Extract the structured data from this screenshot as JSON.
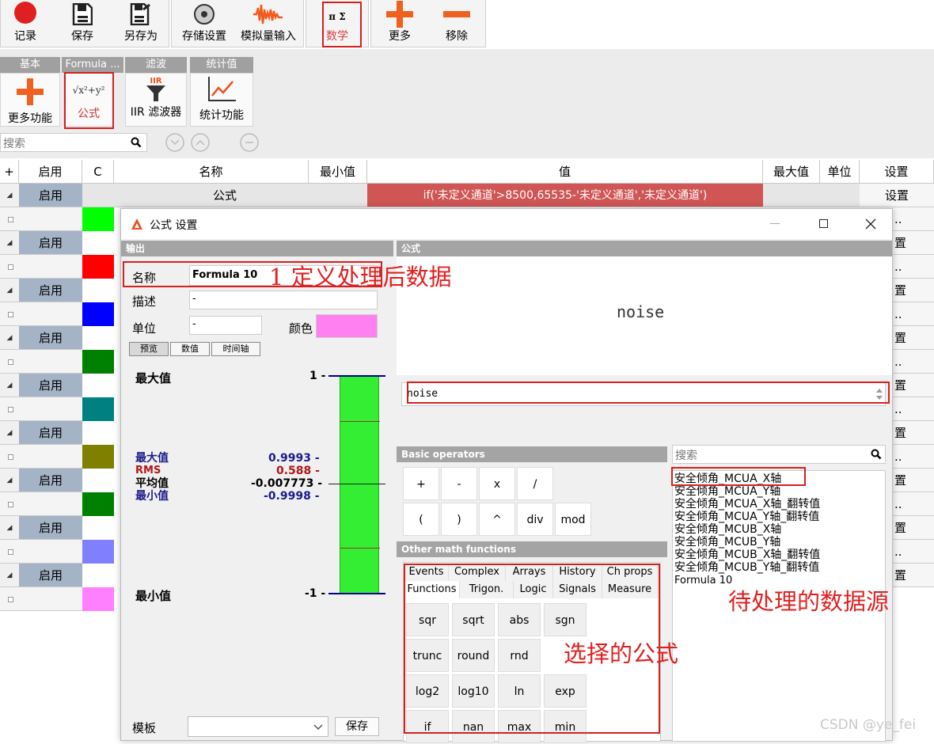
{
  "toolbar": {
    "record": "记录",
    "save": "保存",
    "save_as": "另存为",
    "storage": "存储设置",
    "analog": "模拟量输入",
    "math": "数学",
    "more": "更多",
    "remove": "移除",
    "math_glyph": "π Σ"
  },
  "ribbon": {
    "tabs": [
      "基本",
      "Formula ...",
      "滤波",
      "统计值"
    ],
    "more_func": "更多功能",
    "formula": "公式",
    "formula_icon": "√x²+y²",
    "iir": "IIR 滤波器",
    "iir_icon": "IIR",
    "stats": "统计功能"
  },
  "search": {
    "placeholder": "搜索"
  },
  "table": {
    "headers": {
      "plus": "+",
      "enable": "启用",
      "c": "C",
      "name": "名称",
      "min": "最小值",
      "value": "值",
      "max": "最大值",
      "unit": "单位",
      "settings": "设置"
    },
    "first_row": {
      "enable": "启用",
      "name": "公式",
      "value": "if('未定义通道'>8500,65535-'未定义通道','未定义通道')",
      "settings": "设置"
    },
    "enable_label": "启用",
    "settings_partial": "置",
    "ellipsis": "..",
    "swatches": [
      "#00ff00",
      "#ff0000",
      "#0000ff",
      "#008000",
      "#008080",
      "#808000",
      "#008000",
      "#8080ff",
      "#ff80ff"
    ]
  },
  "dialog": {
    "title": "公式 设置",
    "output_header": "输出",
    "formula_header": "公式",
    "name_label": "名称",
    "name_value": "Formula 10",
    "desc_label": "描述",
    "desc_value": "-",
    "unit_label": "单位",
    "unit_value": "-",
    "color_label": "颜色",
    "color_value": "#ff80f0",
    "preview_tabs": [
      "预览",
      "数值",
      "时间轴"
    ],
    "max_label": "最大值",
    "min_label": "最小值",
    "scale_top": "1 -",
    "scale_bottom": "-1 -",
    "stats": [
      {
        "label": "最大值",
        "value": "0.9993 -",
        "color": "#1b1b8a"
      },
      {
        "label": "RMS",
        "value": "0.588 -",
        "color": "#b01818"
      },
      {
        "label": "平均值",
        "value": "-0.007773 -",
        "color": "#000000"
      },
      {
        "label": "最小值",
        "value": "-0.9998 -",
        "color": "#1b1b8a"
      }
    ],
    "formula_display": "noise",
    "formula_input": "noise",
    "basic_header": "Basic operators",
    "operators": [
      "+",
      "-",
      "x",
      "/",
      "(",
      ")",
      "^",
      "div",
      "mod"
    ],
    "other_header": "Other math functions",
    "func_tabs_row1": [
      "Events",
      "Complex",
      "Arrays",
      "History",
      "Ch props"
    ],
    "func_tabs_row2": [
      "Functions",
      "Trigon.",
      "Logic",
      "Signals",
      "Measure"
    ],
    "functions": [
      "sqr",
      "sqrt",
      "abs",
      "sgn",
      "trunc",
      "round",
      "rnd",
      "log2",
      "log10",
      "ln",
      "exp",
      "if",
      "nan",
      "max",
      "min"
    ],
    "search_placeholder": "搜索",
    "sources": [
      "安全倾角_MCUA_X轴",
      "安全倾角_MCUA_Y轴",
      "安全倾角_MCUA_X轴_翻转值",
      "安全倾角_MCUA_Y轴_翻转值",
      "安全倾角_MCUB_X轴",
      "安全倾角_MCUB_Y轴",
      "安全倾角_MCUB_X轴_翻转值",
      "安全倾角_MCUB_Y轴_翻转值",
      "Formula 10"
    ],
    "template_label": "模板",
    "template_save": "保存"
  },
  "annotations": {
    "define": "1 定义处理后数据",
    "source": "待处理的数据源",
    "chosen": "选择的公式"
  },
  "watermark": "CSDN @ye_fei"
}
